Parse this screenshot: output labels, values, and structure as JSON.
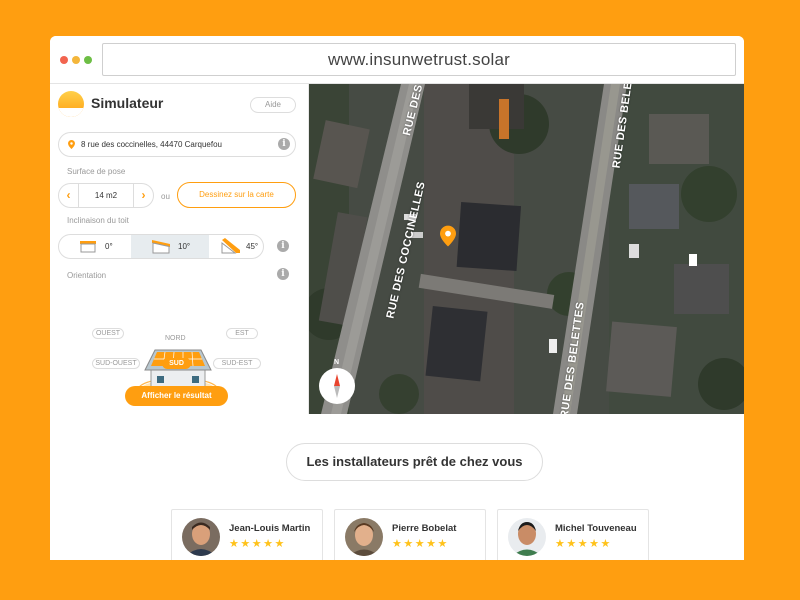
{
  "browser": {
    "url": "www.insunwetrust.solar"
  },
  "simulator": {
    "title": "Simulateur",
    "help_label": "Aide",
    "address": "8 rue des coccinelles, 44470 Carquefou",
    "surface_label": "Surface de pose",
    "surface_value": "14 m2",
    "or_label": "ou",
    "draw_label": "Dessinez sur la carte",
    "incline_label": "Inclinaison du toit",
    "incline_options": [
      {
        "label": "0°",
        "selected": false
      },
      {
        "label": "10°",
        "selected": true
      },
      {
        "label": "45°",
        "selected": false
      }
    ],
    "orientation_label": "Orientation",
    "orientation": {
      "north": "NORD",
      "west": "OUEST",
      "east": "EST",
      "southwest": "SUD-OUEST",
      "south": "SUD",
      "southeast": "SUD-EST",
      "selected": "SUD"
    },
    "result_label": "Afficher le résultat"
  },
  "map": {
    "streets": [
      "RUE DES COCCINELLES",
      "RUE DES BELETTES",
      "RUE DES",
      "RUE DES BELE"
    ],
    "compass_label": "N"
  },
  "installers": {
    "heading": "Les installateurs prêt de chez vous",
    "cards": [
      {
        "name": "Jean-Louis Martin",
        "stars": "★★★★★",
        "rating": 5
      },
      {
        "name": "Pierre Bobelat",
        "stars": "★★★★★",
        "rating": 5
      },
      {
        "name": "Michel Touveneau",
        "stars": "★★★★★",
        "rating": 5
      }
    ]
  },
  "colors": {
    "accent": "#FF9E10",
    "background": "#FF9E10",
    "star": "#FFC21A"
  },
  "icons": [
    "location-pin-icon",
    "info-icon",
    "chevron-left-icon",
    "chevron-right-icon",
    "sun-logo-icon",
    "compass-icon",
    "house-icon",
    "map-marker-icon"
  ]
}
